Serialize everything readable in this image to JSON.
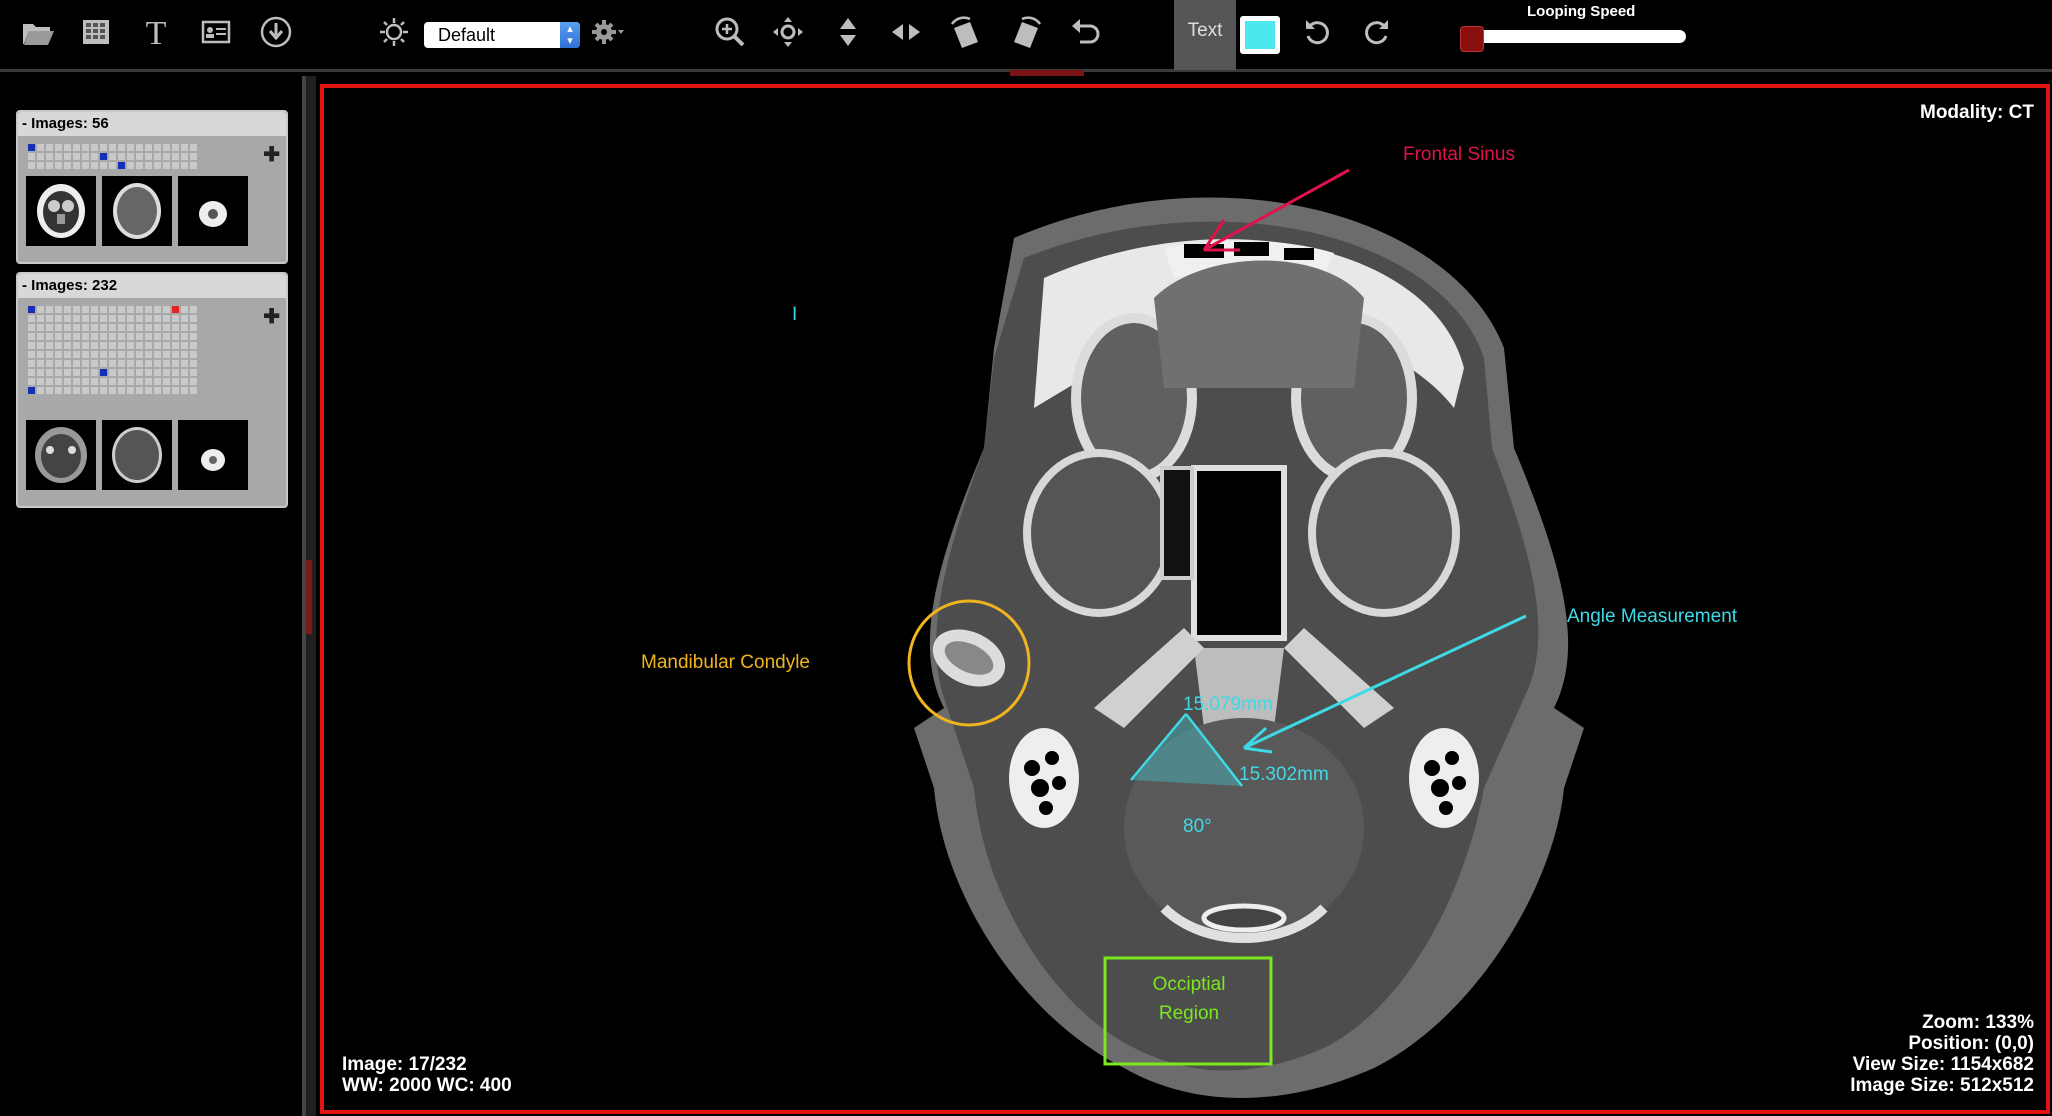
{
  "toolbar": {
    "tools": [
      "open-folder",
      "grid-layout",
      "text-tool",
      "patient-info",
      "download",
      "brightness"
    ],
    "preset_value": "Default",
    "view_tools": [
      "zoom",
      "pan",
      "scroll-vertical",
      "scroll-horizontal",
      "rotate-left-image",
      "rotate-right-image",
      "undo"
    ],
    "text_tool_label": "Text",
    "annotation_color": "#4ce8ef",
    "looping_speed_label": "Looping Speed",
    "looping_speed_value": 0
  },
  "series": [
    {
      "label": "- Images: 56"
    },
    {
      "label": "- Images: 232"
    }
  ],
  "viewport": {
    "modality": "Modality: CT",
    "image_index": "Image: 17/232",
    "window": "WW: 2000 WC: 400",
    "zoom": "Zoom: 133%",
    "position": "Position: (0,0)",
    "view_size": "View Size: 1154x682",
    "image_size": "Image Size: 512x512"
  },
  "annotations": {
    "frontal_sinus": "Frontal Sinus",
    "angle_measurement": "Angle Measurement",
    "mandibular_condyle": "Mandibular Condyle",
    "length_1": "15.079mm",
    "length_2": "15.302mm",
    "angle": "80°",
    "occipital_line1": "Occiptial",
    "occipital_line2": "Region",
    "cursor": "I"
  },
  "colors": {
    "frontal": "#e0124a",
    "angle": "#3fd9e6",
    "condyle": "#f0b420",
    "occipital": "#7ae81e",
    "frame": "#e01414"
  }
}
